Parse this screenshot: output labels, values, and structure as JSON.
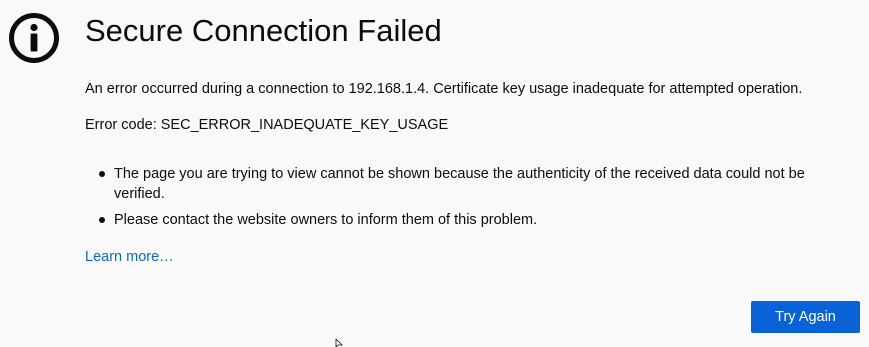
{
  "error": {
    "icon": "info-circle-icon",
    "title": "Secure Connection Failed",
    "description": "An error occurred during a connection to 192.168.1.4. Certificate key usage inadequate for attempted operation.",
    "error_code": "Error code: SEC_ERROR_INADEQUATE_KEY_USAGE",
    "bullets": [
      "The page you are trying to view cannot be shown because the authenticity of the received data could not be verified.",
      "Please contact the website owners to inform them of this problem."
    ],
    "learn_more_label": "Learn more…",
    "try_again_label": "Try Again"
  },
  "colors": {
    "background": "#f9f9fa",
    "text": "#0c0c0d",
    "link": "#0a67d8",
    "primary_button": "#0a62d8"
  }
}
